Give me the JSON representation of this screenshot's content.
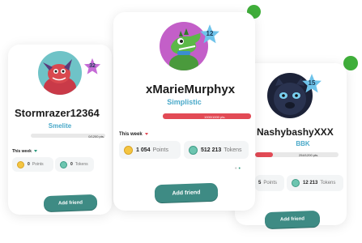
{
  "cards": {
    "left": {
      "username": "Stormrazer12364",
      "rank": "Smelite",
      "level": "32",
      "progress_text": "0/1200 pts.",
      "progress_fraction": 0.0,
      "week_label": "This week",
      "points_value": "0",
      "points_label": "Points",
      "tokens_value": "0",
      "tokens_label": "Tokens",
      "button_label": "Add friend"
    },
    "center": {
      "username": "xMarieMurphyx",
      "rank": "Simplistic",
      "level": "12",
      "progress_text": "1000/1000 pts.",
      "progress_fraction": 1.0,
      "week_label": "This week",
      "points_value": "1 054",
      "points_label": "Points",
      "tokens_value": "512 213",
      "tokens_label": "Tokens",
      "button_label": "Add friend"
    },
    "right": {
      "username": "NashybashyXXX",
      "rank": "BBK",
      "level": "15",
      "progress_text": "254/1200 pts.",
      "progress_fraction": 0.21,
      "points_value": "5",
      "points_label": "Points",
      "tokens_value": "12 213",
      "tokens_label": "Tokens",
      "button_label": "Add friend"
    }
  },
  "colors": {
    "accent_red": "#e24a55",
    "button_teal": "#3e8b84",
    "rank_blue": "#4aa9c9",
    "status_green": "#3fae3a",
    "badge_pink": "#c56bd6",
    "badge_blue": "#6ec3ea"
  },
  "icons": {
    "points": "coin-icon",
    "tokens": "token-icon",
    "online": "online-indicator-dot"
  }
}
